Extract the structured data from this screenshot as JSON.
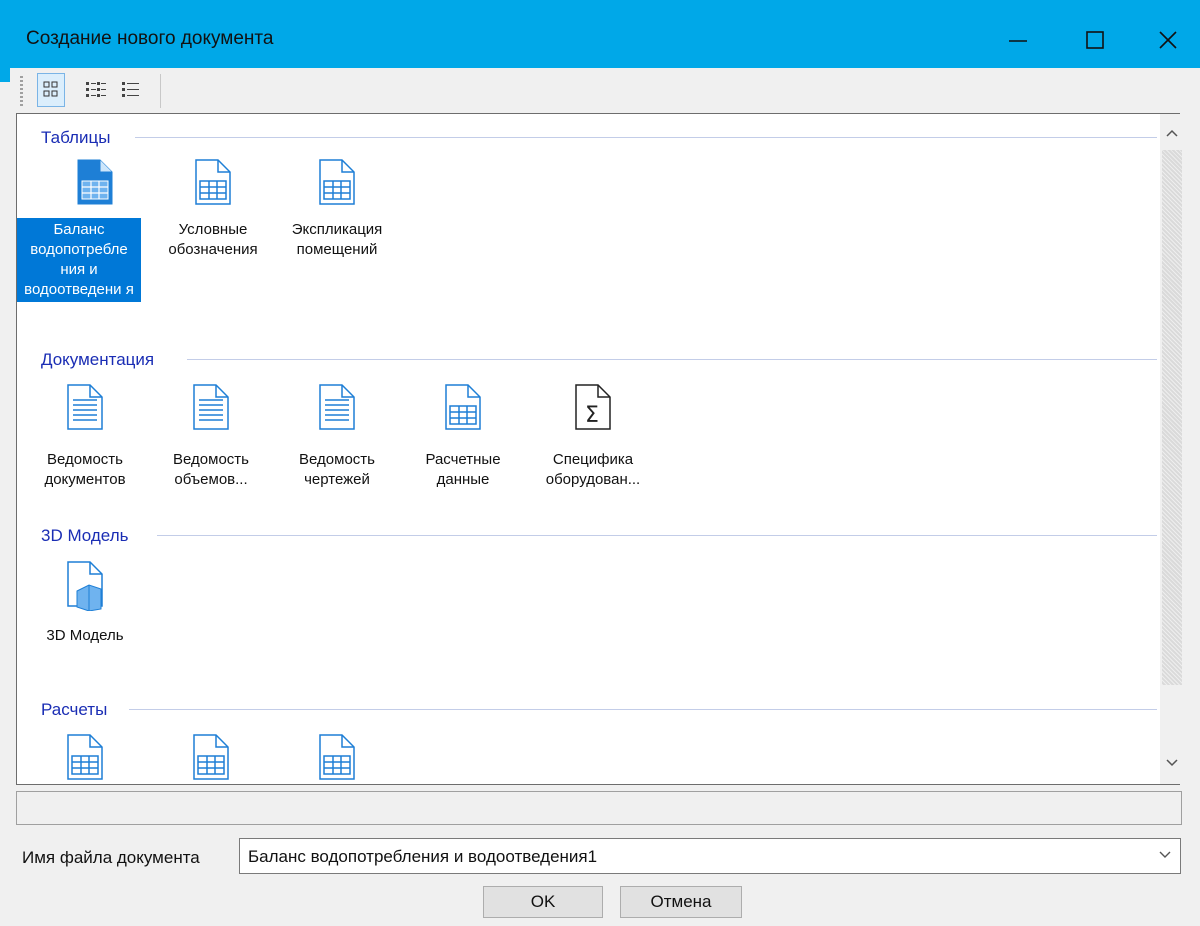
{
  "window": {
    "title": "Создание нового документа"
  },
  "categories": [
    {
      "name": "Таблицы",
      "items": [
        {
          "label": "Баланс водопотребле ния и водоотведени я",
          "icon": "table-document-icon",
          "selected": true
        },
        {
          "label": "Условные обозначения",
          "icon": "table-document-icon",
          "selected": false
        },
        {
          "label": "Экспликация помещений",
          "icon": "table-document-icon",
          "selected": false
        }
      ]
    },
    {
      "name": "Документация",
      "items": [
        {
          "label": "Ведомость документов",
          "icon": "text-document-icon"
        },
        {
          "label": "Ведомость объемов...",
          "icon": "text-document-icon"
        },
        {
          "label": "Ведомость чертежей",
          "icon": "text-document-icon"
        },
        {
          "label": "Расчетные данные",
          "icon": "table-document-icon"
        },
        {
          "label": "Специфика оборудован...",
          "icon": "sigma-document-icon"
        }
      ]
    },
    {
      "name": "3D Модель",
      "items": [
        {
          "label": "3D Модель",
          "icon": "3d-model-document-icon"
        }
      ]
    },
    {
      "name": "Расчеты",
      "items": []
    }
  ],
  "filename": {
    "label": "Имя файла документа",
    "value": "Баланс водопотребления и водоотведения1"
  },
  "buttons": {
    "ok": "OK",
    "cancel": "Отмена"
  },
  "colors": {
    "titlebar": "#00a8e8",
    "selection": "#0078d7",
    "category_text": "#1a2db4",
    "icon_blue": "#1e7fd6"
  }
}
